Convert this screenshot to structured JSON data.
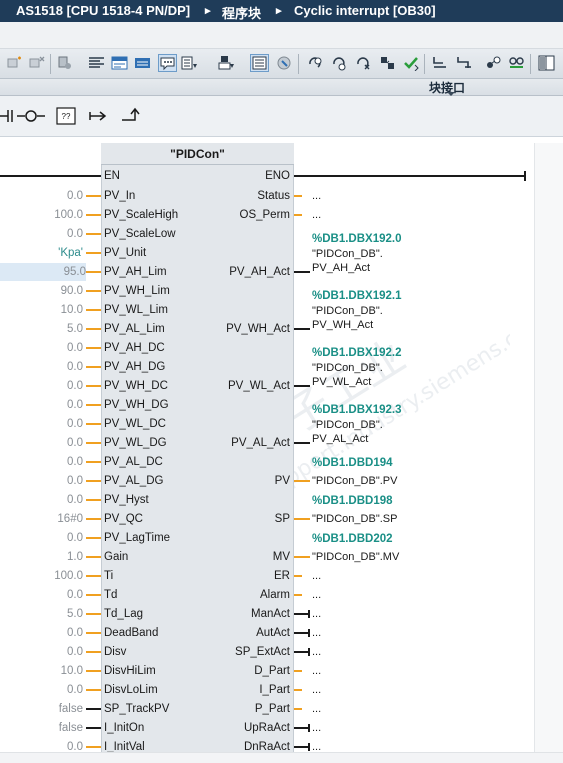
{
  "breadcrumb": {
    "device": "AS1518 [CPU 1518-4 PN/DP]",
    "folder": "程序块",
    "block": "Cyclic interrupt [OB30]",
    "separator": "▸"
  },
  "interface_bar": {
    "label": "块接口"
  },
  "fb": {
    "name": "\"PIDCon\"",
    "en": "EN",
    "eno": "ENO",
    "inputs": [
      {
        "value": "0.0",
        "pin": "PV_In"
      },
      {
        "value": "100.0",
        "pin": "PV_ScaleHigh"
      },
      {
        "value": "0.0",
        "pin": "PV_ScaleLow"
      },
      {
        "value": "'Kpa'",
        "pin": "PV_Unit"
      },
      {
        "value": "95.0",
        "pin": "PV_AH_Lim"
      },
      {
        "value": "90.0",
        "pin": "PV_WH_Lim"
      },
      {
        "value": "10.0",
        "pin": "PV_WL_Lim"
      },
      {
        "value": "5.0",
        "pin": "PV_AL_Lim"
      },
      {
        "value": "0.0",
        "pin": "PV_AH_DC"
      },
      {
        "value": "0.0",
        "pin": "PV_AH_DG"
      },
      {
        "value": "0.0",
        "pin": "PV_WH_DC"
      },
      {
        "value": "0.0",
        "pin": "PV_WH_DG"
      },
      {
        "value": "0.0",
        "pin": "PV_WL_DC"
      },
      {
        "value": "0.0",
        "pin": "PV_WL_DG"
      },
      {
        "value": "0.0",
        "pin": "PV_AL_DC"
      },
      {
        "value": "0.0",
        "pin": "PV_AL_DG"
      },
      {
        "value": "0.0",
        "pin": "PV_Hyst"
      },
      {
        "value": "16#0",
        "pin": "PV_QC"
      },
      {
        "value": "0.0",
        "pin": "PV_LagTime"
      },
      {
        "value": "1.0",
        "pin": "Gain"
      },
      {
        "value": "100.0",
        "pin": "Ti"
      },
      {
        "value": "0.0",
        "pin": "Td"
      },
      {
        "value": "5.0",
        "pin": "Td_Lag"
      },
      {
        "value": "0.0",
        "pin": "DeadBand"
      },
      {
        "value": "0.0",
        "pin": "Disv"
      },
      {
        "value": "10.0",
        "pin": "DisvHiLim"
      },
      {
        "value": "0.0",
        "pin": "DisvLoLim"
      },
      {
        "value": "false",
        "pin": "SP_TrackPV"
      },
      {
        "value": "false",
        "pin": "I_InitOn"
      },
      {
        "value": "0.0",
        "pin": "I_InitVal"
      }
    ],
    "outputs": {
      "status": "Status",
      "os_perm": "OS_Perm",
      "pv_ah_act": "PV_AH_Act",
      "pv_wh_act": "PV_WH_Act",
      "pv_wl_act": "PV_WL_Act",
      "pv_al_act": "PV_AL_Act",
      "pv": "PV",
      "sp": "SP",
      "mv": "MV",
      "er": "ER",
      "alarm": "Alarm",
      "manact": "ManAct",
      "autact": "AutAct",
      "sp_extact": "SP_ExtAct",
      "d_part": "D_Part",
      "i_part": "I_Part",
      "p_part": "P_Part",
      "upraact": "UpRaAct",
      "dnraact": "DnRaAct"
    },
    "unconnected": "...",
    "tags": {
      "ah": {
        "addr": "%DB1.DBX192.0",
        "db": "\"PIDCon_DB\".",
        "member": "PV_AH_Act"
      },
      "wh": {
        "addr": "%DB1.DBX192.1",
        "db": "\"PIDCon_DB\".",
        "member": "PV_WH_Act"
      },
      "wl": {
        "addr": "%DB1.DBX192.2",
        "db": "\"PIDCon_DB\".",
        "member": "PV_WL_Act"
      },
      "al": {
        "addr": "%DB1.DBX192.3",
        "db": "\"PIDCon_DB\".",
        "member": "PV_AL_Act"
      },
      "pv": {
        "addr": "%DB1.DBD194",
        "full": "\"PIDCon_DB\".PV"
      },
      "sp": {
        "addr": "%DB1.DBD198",
        "full": "\"PIDCon_DB\".SP"
      },
      "mv": {
        "addr": "%DB1.DBD202",
        "full": "\"PIDCon_DB\".MV"
      }
    }
  },
  "colors": {
    "titlebar": "#1f3c59",
    "wire": "#f0a020",
    "tag_address": "#1a8f86",
    "const_string": "#2e8c8c"
  }
}
